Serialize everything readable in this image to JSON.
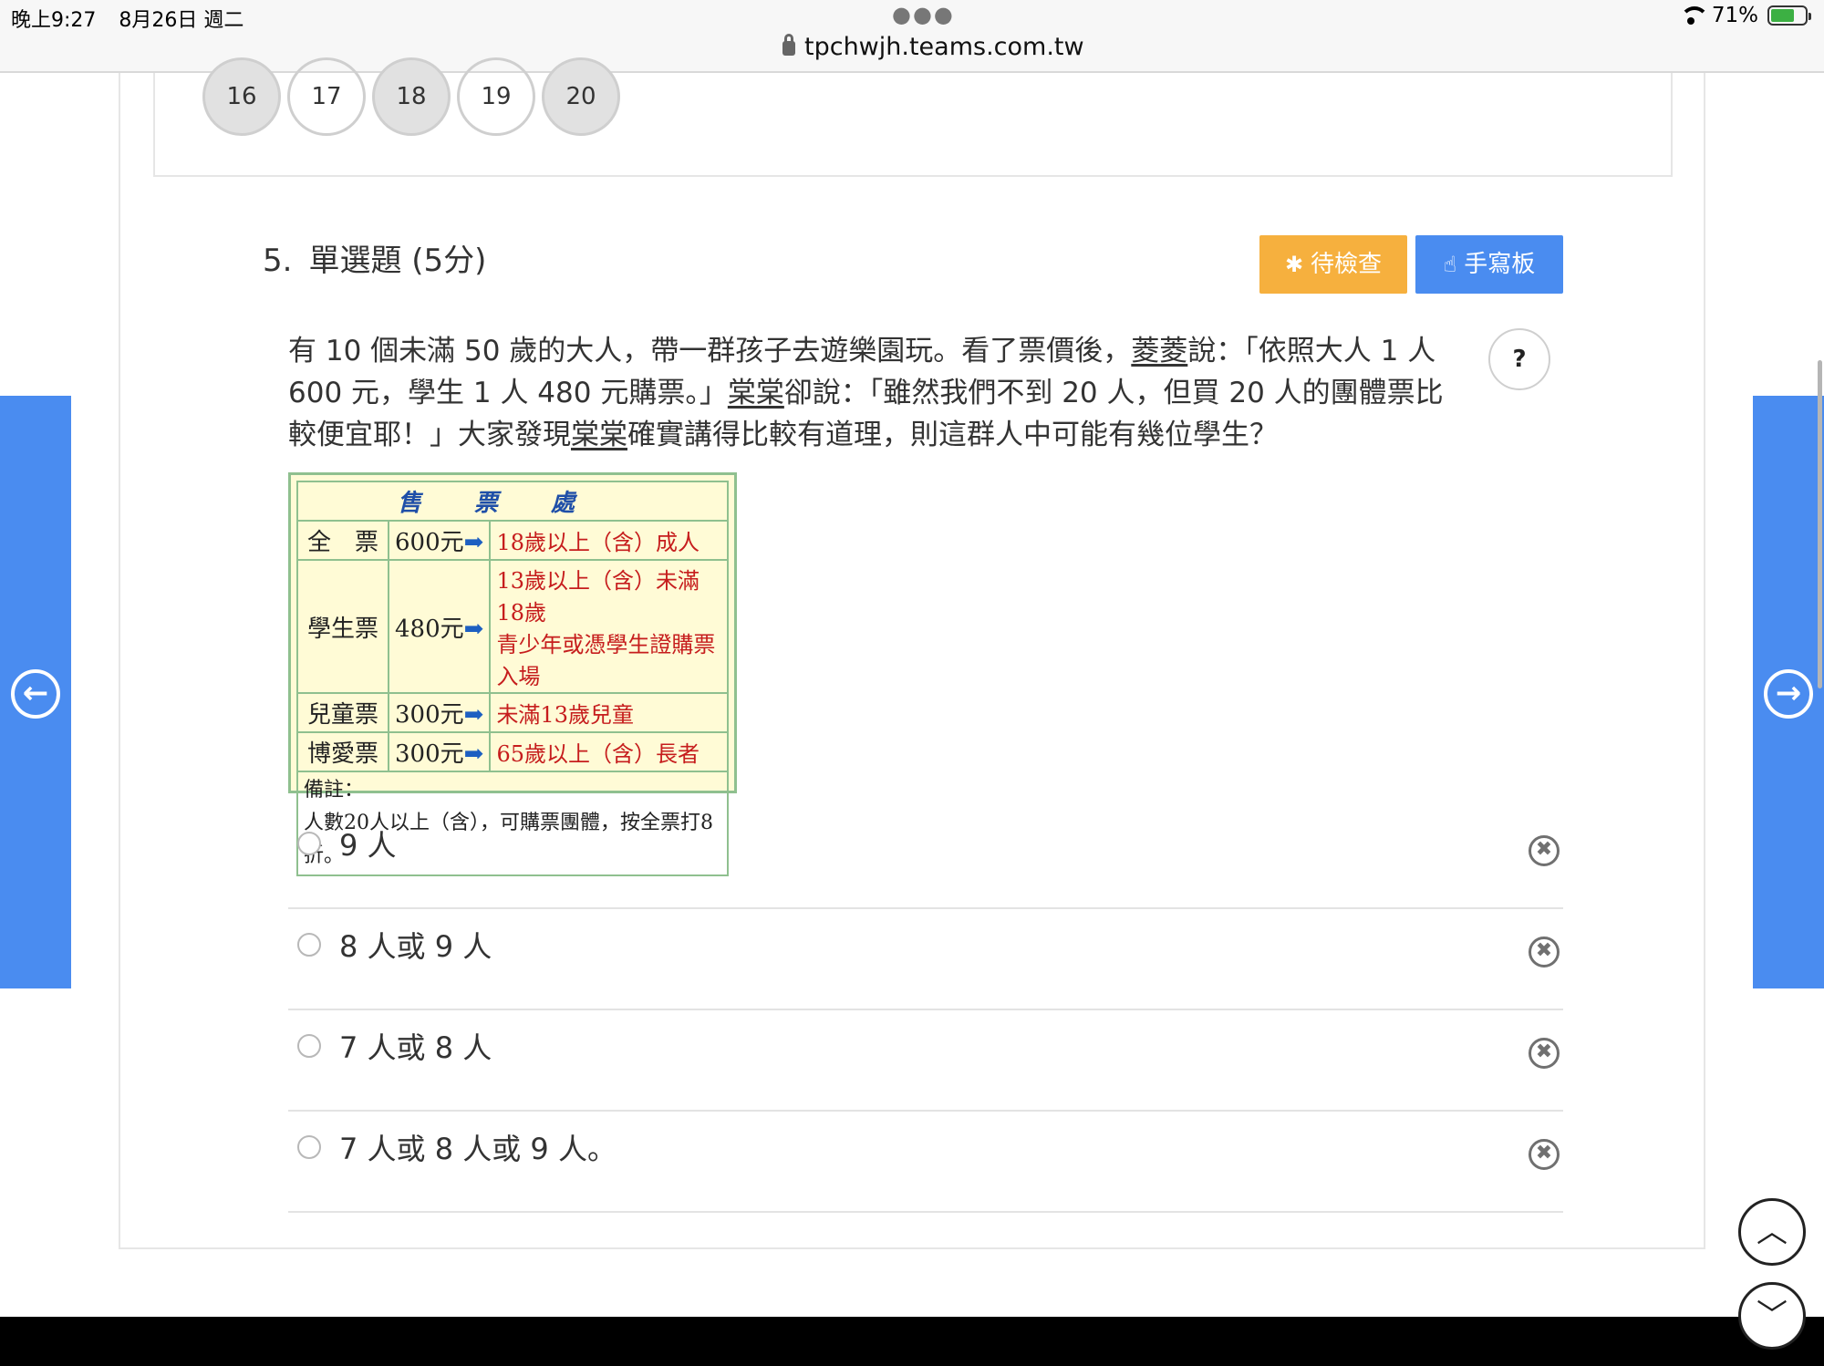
{
  "status_bar": {
    "time": "晚上9:27",
    "date": "8月26日 週二",
    "url": "tpchwjh.teams.com.tw",
    "battery": "71%"
  },
  "question_nav": [
    "16",
    "17",
    "18",
    "19",
    "20"
  ],
  "question": {
    "number": "5.",
    "type": "單選題 (5分)",
    "pending_button": "待檢查",
    "handwrite_button": "手寫板",
    "help_label": "?",
    "text_part1": "有 10 個未滿 50 歲的大人，帶一群孩子去遊樂園玩。看了票價後，",
    "name1": "菱菱",
    "text_part2": "說：「依照大人 1 人 600 元，學生 1 人 480 元購票。」",
    "name2": "棠棠",
    "text_part3": "卻說：「雖然我們不到 20 人，但買 20 人的團體票比較便宜耶！」大家發現",
    "name3": "棠棠",
    "text_part4": "確實講得比較有道理，則這群人中可能有幾位學生？"
  },
  "ticket_table": {
    "header": "售票處",
    "rows": [
      {
        "name": "全　票",
        "price": "600元",
        "desc": "18歲以上（含）成人"
      },
      {
        "name": "學生票",
        "price": "480元",
        "desc": "13歲以上（含）未滿18歲",
        "desc2": "青少年或憑學生證購票入場"
      },
      {
        "name": "兒童票",
        "price": "300元",
        "desc": "未滿13歲兒童"
      },
      {
        "name": "博愛票",
        "price": "300元",
        "desc": "65歲以上（含）長者"
      }
    ],
    "note_title": "備註：",
    "note_text": "人數20人以上（含），可購票團體，按全票打8折。"
  },
  "options": [
    {
      "label": "9 人"
    },
    {
      "label": "8 人或 9 人"
    },
    {
      "label": "7 人或 8 人"
    },
    {
      "label": "7 人或 8 人或 9 人。"
    }
  ],
  "icons": {
    "prev": "arrow-left-icon",
    "next": "arrow-right-icon",
    "scroll_up": "chevron-up-icon",
    "scroll_down": "chevron-down-icon"
  },
  "colors": {
    "accent_blue": "#4a8cf0",
    "pending_orange": "#f6b03e"
  }
}
